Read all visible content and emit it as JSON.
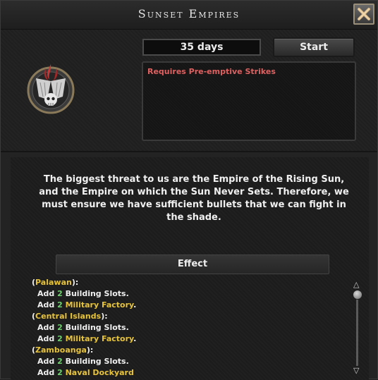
{
  "window": {
    "title": "Sunset Empires",
    "close_icon": "close-x-icon",
    "emblem_icon": "skull-wings-emblem-icon"
  },
  "decision": {
    "duration": "35 days",
    "start_label": "Start",
    "requirement": "Requires Pre-emptive Strikes",
    "description": "The biggest threat to us are the Empire of the Rising Sun, and the Empire on which the Sun Never Sets. Therefore, we must ensure we have sufficient bullets that we can fight in the shade."
  },
  "effect": {
    "header": "Effect",
    "groups": [
      {
        "region": "Palawan",
        "lines": [
          {
            "pre": "Add ",
            "num": "2",
            "mid": " Building Slots",
            "highlight": "",
            "post": "."
          },
          {
            "pre": "Add ",
            "num": "2",
            "mid": " ",
            "highlight": "Military Factory",
            "post": "."
          }
        ]
      },
      {
        "region": "Central Islands",
        "lines": [
          {
            "pre": "Add ",
            "num": "2",
            "mid": " Building Slots",
            "highlight": "",
            "post": "."
          },
          {
            "pre": "Add ",
            "num": "2",
            "mid": " ",
            "highlight": "Military Factory",
            "post": "."
          }
        ]
      },
      {
        "region": "Zamboanga",
        "lines": [
          {
            "pre": "Add ",
            "num": "2",
            "mid": " Building Slots",
            "highlight": "",
            "post": "."
          },
          {
            "pre": "Add ",
            "num": "2",
            "mid": " ",
            "highlight": "Naval Dockyard",
            "post": ""
          }
        ]
      }
    ]
  },
  "colors": {
    "requirement": "#e06060",
    "highlight": "#e7c33a",
    "number": "#6fd06f"
  }
}
